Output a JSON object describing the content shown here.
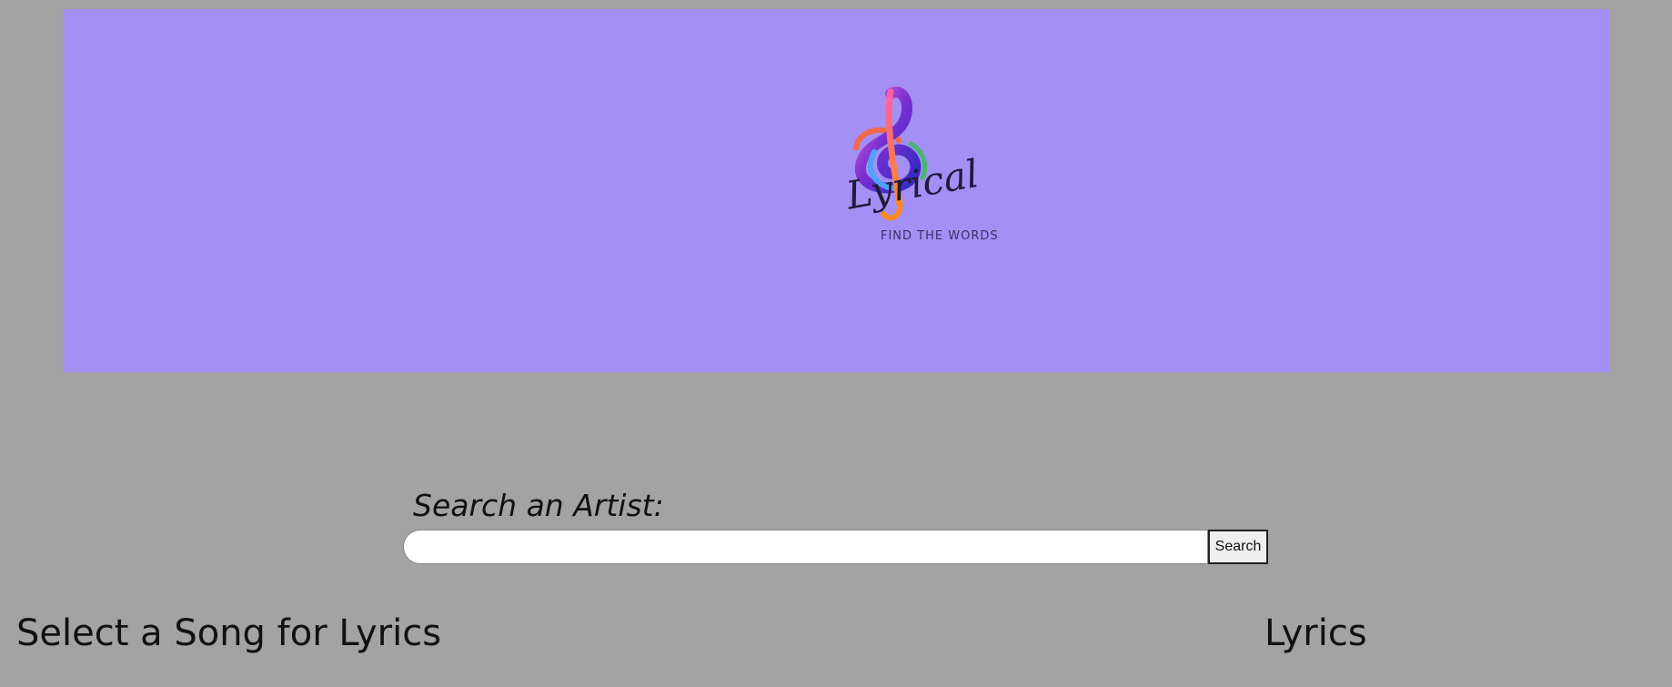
{
  "banner": {
    "background_color": "#a48ff5",
    "logo": {
      "icon": "treble-clef-icon",
      "wordmark": "Lyrical",
      "tagline": "FIND THE WORDS"
    }
  },
  "search": {
    "label": "Search an Artist:",
    "input_value": "",
    "button_label": "Search"
  },
  "songs": {
    "heading": "Select a Song for Lyrics"
  },
  "lyrics": {
    "heading": "Lyrics"
  }
}
